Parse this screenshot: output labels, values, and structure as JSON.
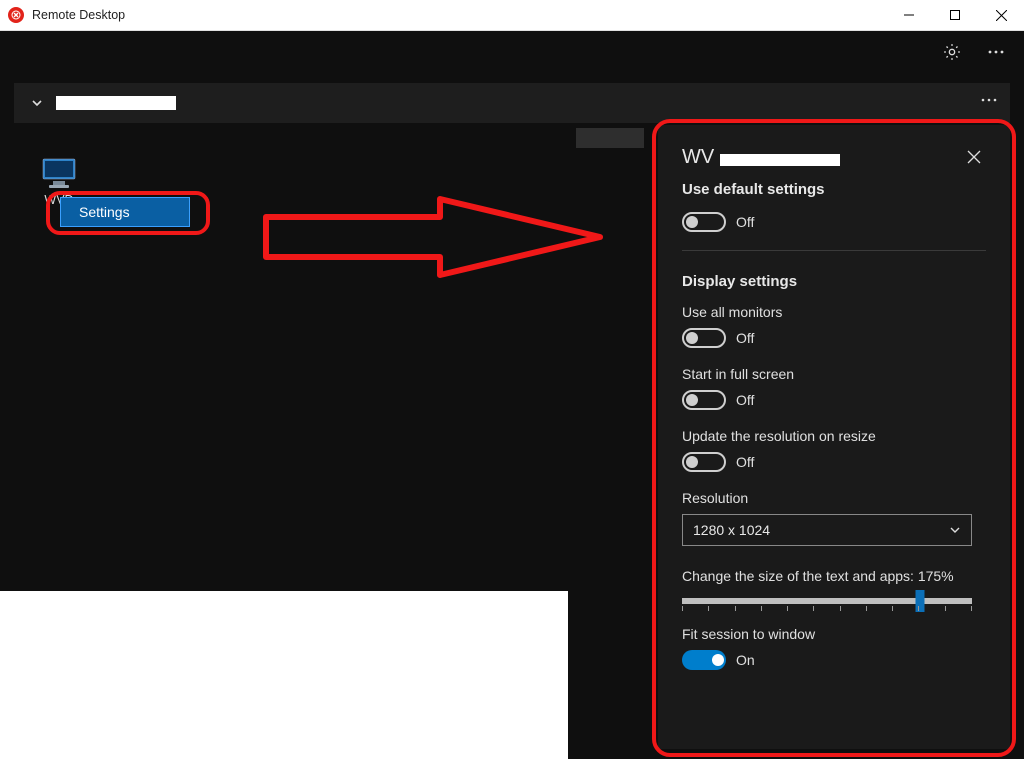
{
  "window": {
    "title": "Remote Desktop"
  },
  "workspace": {
    "tile_label": "WVD"
  },
  "context_menu": {
    "settings": "Settings"
  },
  "panel": {
    "title_prefix": "WV",
    "use_default_settings": {
      "label": "Use default settings",
      "state": "Off"
    },
    "display_settings_header": "Display settings",
    "use_all_monitors": {
      "label": "Use all monitors",
      "state": "Off"
    },
    "start_full_screen": {
      "label": "Start in full screen",
      "state": "Off"
    },
    "update_resolution_resize": {
      "label": "Update the resolution on resize",
      "state": "Off"
    },
    "resolution": {
      "label": "Resolution",
      "value": "1280 x 1024"
    },
    "text_size": {
      "label": "Change the size of the text and apps: 175%"
    },
    "fit_session": {
      "label": "Fit session to window",
      "state": "On"
    }
  }
}
